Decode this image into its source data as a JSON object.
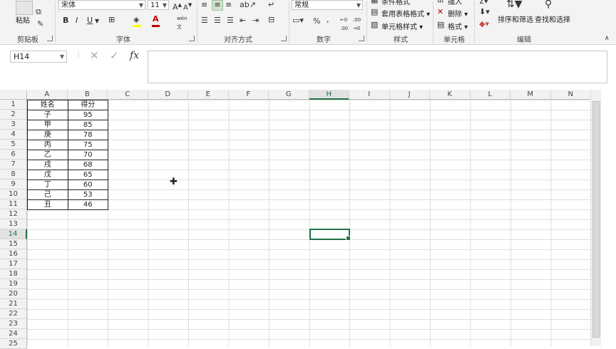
{
  "ribbon": {
    "clipboard": {
      "group_label": "剪贴板",
      "paste_label": "粘贴"
    },
    "font": {
      "group_label": "字体",
      "font_name": "宋体",
      "font_size": "11",
      "bold": "B",
      "italic": "I",
      "underline": "U",
      "wen_label": "wén"
    },
    "alignment": {
      "group_label": "对齐方式"
    },
    "number": {
      "group_label": "数字",
      "format": "常规",
      "percent": "%",
      "comma": ","
    },
    "styles": {
      "group_label": "样式",
      "cond_format": "条件格式",
      "table_format": "套用表格格式",
      "cell_style": "单元格样式"
    },
    "cells": {
      "group_label": "单元格",
      "insert": "插入",
      "delete": "删除",
      "format": "格式"
    },
    "editing": {
      "group_label": "编辑",
      "sort_filter": "排序和筛选",
      "find_select": "查找和选择"
    }
  },
  "formula_bar": {
    "name_box": "H14",
    "cancel": "✕",
    "enter": "✓",
    "fx": "fx",
    "content": ""
  },
  "columns": [
    "A",
    "B",
    "C",
    "D",
    "E",
    "F",
    "G",
    "H",
    "I",
    "J",
    "K",
    "L",
    "M",
    "N"
  ],
  "rows": [
    "1",
    "2",
    "3",
    "4",
    "5",
    "6",
    "7",
    "8",
    "9",
    "10",
    "11",
    "12",
    "13",
    "14",
    "15",
    "16",
    "17",
    "18",
    "19",
    "20",
    "21",
    "22",
    "23",
    "24",
    "25"
  ],
  "table": {
    "headers": [
      "姓名",
      "得分"
    ],
    "rows": [
      [
        "子",
        "95"
      ],
      [
        "甲",
        "85"
      ],
      [
        "庚",
        "78"
      ],
      [
        "丙",
        "75"
      ],
      [
        "乙",
        "70"
      ],
      [
        "戌",
        "68"
      ],
      [
        "戊",
        "65"
      ],
      [
        "丁",
        "60"
      ],
      [
        "己",
        "53"
      ],
      [
        "丑",
        "46"
      ]
    ]
  },
  "active_cell": {
    "column": "H",
    "row": "14"
  },
  "colors": {
    "accent": "#217346",
    "gridline": "#dedede",
    "ribbon_bg": "#f3f3f3"
  }
}
